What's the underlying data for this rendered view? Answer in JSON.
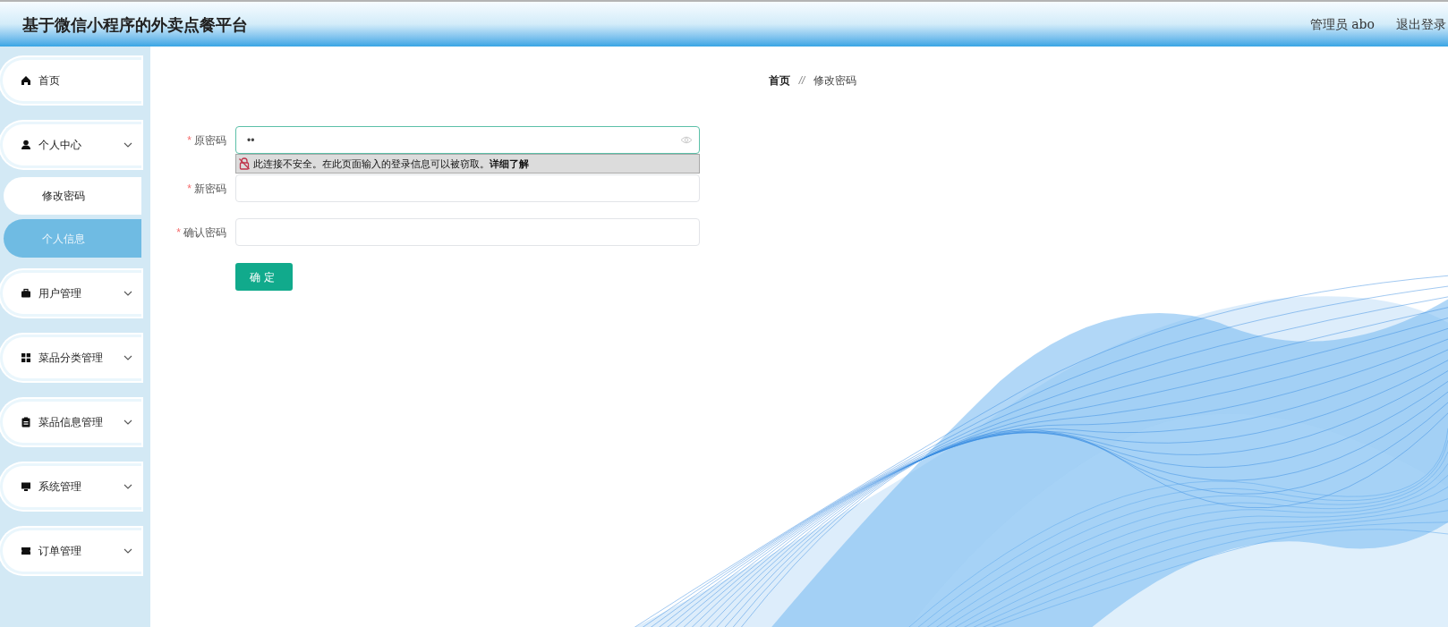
{
  "header": {
    "title": "基于微信小程序的外卖点餐平台",
    "user": "管理员 abo",
    "logout": "退出登录"
  },
  "sidebar": {
    "items": [
      {
        "label": "首页",
        "kind": "link"
      },
      {
        "label": "个人中心",
        "kind": "group",
        "children": [
          {
            "label": "修改密码",
            "selected": false
          },
          {
            "label": "个人信息",
            "selected": true
          }
        ]
      },
      {
        "label": "用户管理",
        "kind": "group"
      },
      {
        "label": "菜品分类管理",
        "kind": "group"
      },
      {
        "label": "菜品信息管理",
        "kind": "group"
      },
      {
        "label": "系统管理",
        "kind": "group"
      },
      {
        "label": "订单管理",
        "kind": "group"
      }
    ]
  },
  "breadcrumb": [
    "首页",
    "修改密码"
  ],
  "breadcrumb_separator": "//",
  "form": {
    "fields": [
      {
        "label": "原密码",
        "required": true,
        "value": "••",
        "focused": true,
        "warning": "此连接不安全。在此页面输入的登录信息可以被窃取。**详细了解**"
      },
      {
        "label": "新密码",
        "required": true,
        "focused": false
      },
      {
        "label": "确认密码",
        "required": true,
        "focused": false
      }
    ],
    "required_mark": "*",
    "submit": "确定"
  }
}
